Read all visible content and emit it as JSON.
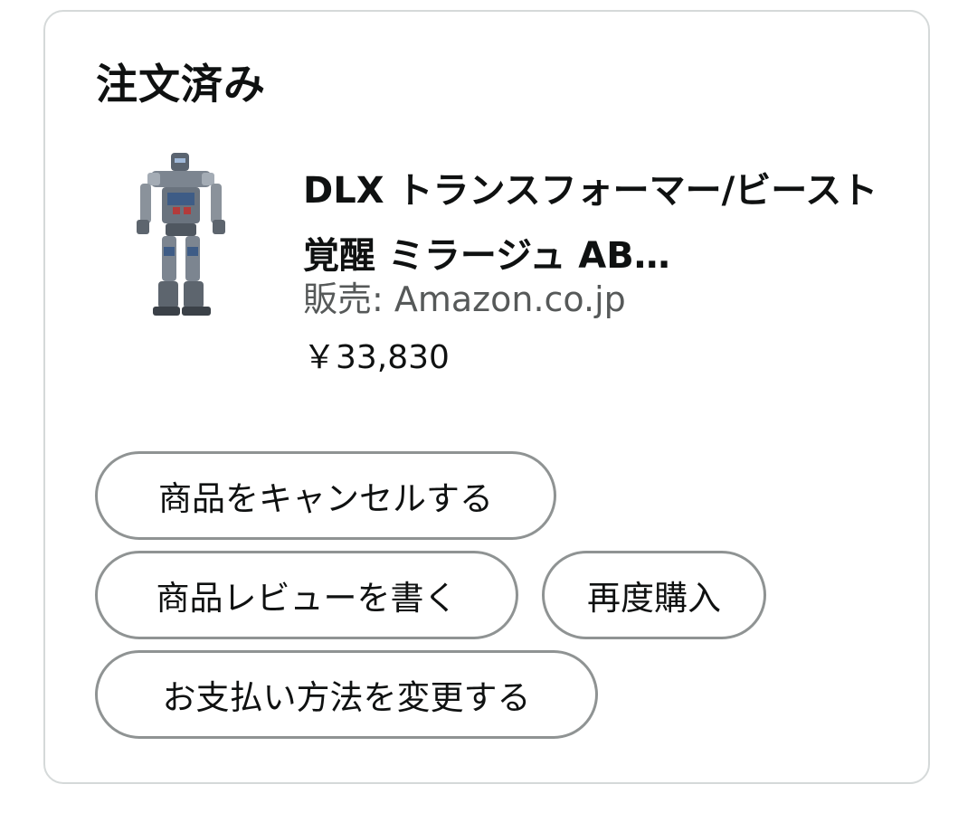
{
  "order": {
    "status": "注文済み",
    "product": {
      "title": "DLX トランスフォーマー/ビースト覚醒 ミラージュ AB…",
      "seller": "販売: Amazon.co.jp",
      "price": "￥33,830",
      "image_icon": "robot-figure-icon"
    },
    "actions": {
      "cancel": "商品をキャンセルする",
      "review": "商品レビューを書く",
      "rebuy": "再度購入",
      "change_payment": "お支払い方法を変更する"
    }
  },
  "colors": {
    "border": "#d5d9d9",
    "button_border": "#8f9393",
    "text": "#0f1111",
    "secondary_text": "#565959"
  }
}
